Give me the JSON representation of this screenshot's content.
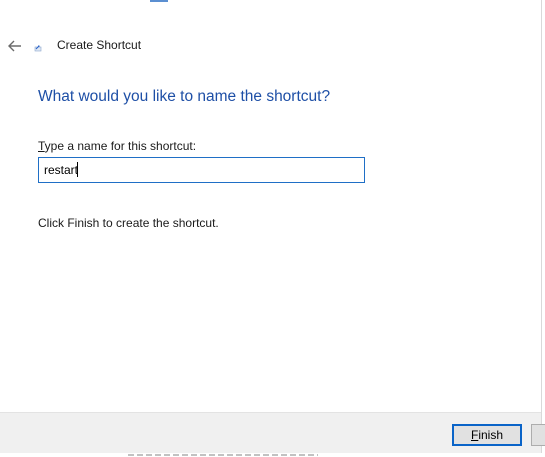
{
  "header": {
    "title": "Create Shortcut",
    "back_icon": "arrow-left-icon",
    "wizard_icon": "shortcut-wizard-icon"
  },
  "main": {
    "heading": "What would you like to name the shortcut?",
    "field_label_access_key": "T",
    "field_label_rest": "ype a name for this shortcut:",
    "name_value": "restart",
    "hint": "Click Finish to create the shortcut."
  },
  "footer": {
    "finish_access_key": "F",
    "finish_rest": "inish"
  },
  "colors": {
    "heading": "#1e4fa6",
    "input_border_focus": "#1f6fc6",
    "footer_bg": "#f0f0f0",
    "default_button_border": "#0a64c8"
  }
}
